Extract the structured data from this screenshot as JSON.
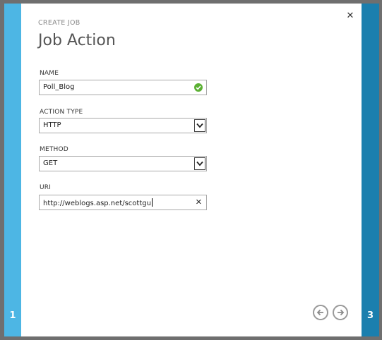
{
  "dialog": {
    "subtitle": "CREATE JOB",
    "title": "Job Action",
    "close_icon": "close-icon"
  },
  "steps": {
    "left": "1",
    "right": "3"
  },
  "fields": {
    "name": {
      "label": "NAME",
      "value": "Poll_Blog",
      "status_icon": "check-icon"
    },
    "action_type": {
      "label": "ACTION TYPE",
      "value": "HTTP"
    },
    "method": {
      "label": "METHOD",
      "value": "GET"
    },
    "uri": {
      "label": "URI",
      "value": "http://weblogs.asp.net/scottgu"
    }
  },
  "nav": {
    "prev_icon": "arrow-left-icon",
    "next_icon": "arrow-right-icon"
  },
  "colors": {
    "left_strip": "#4db6e4",
    "right_strip": "#1b7fae",
    "success": "#5bb033"
  }
}
